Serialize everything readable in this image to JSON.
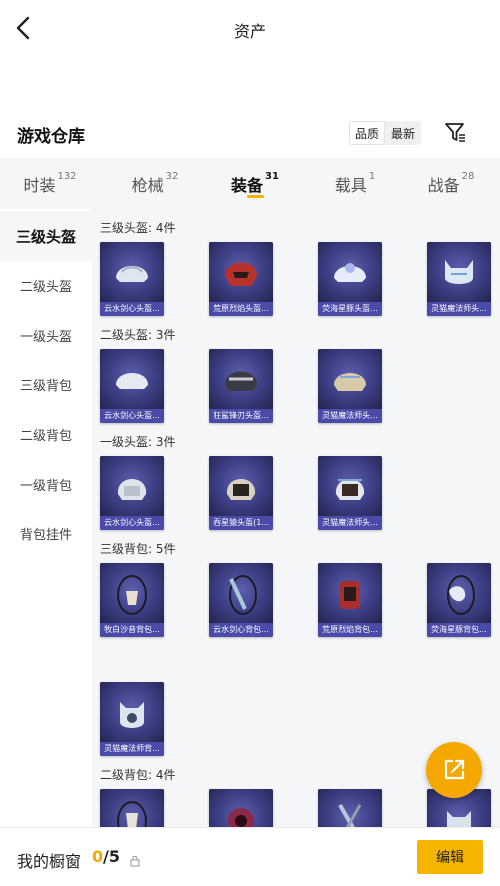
{
  "header": {
    "title": "资产"
  },
  "warehouse": {
    "title": "游戏仓库",
    "sort_options": [
      "品质",
      "最新"
    ]
  },
  "tabs": [
    {
      "label": "时装",
      "count": "132"
    },
    {
      "label": "枪械",
      "count": "32"
    },
    {
      "label": "装备",
      "count": "31"
    },
    {
      "label": "载具",
      "count": "1"
    },
    {
      "label": "战备",
      "count": "28"
    }
  ],
  "sidebar": {
    "items": [
      "三级头盔",
      "二级头盔",
      "一级头盔",
      "三级背包",
      "二级背包",
      "一级背包",
      "背包挂件"
    ]
  },
  "sections": [
    {
      "title": "三级头盔: 4件",
      "items": [
        "云水剑心头盔...",
        "荒原烈焰头盔...",
        "荧海星豚头盔...",
        "灵猫魔法师头..."
      ]
    },
    {
      "title": "二级头盔: 3件",
      "items": [
        "云水剑心头盔...",
        "狂鲨锋刃头盔...",
        "灵猫魔法师头..."
      ]
    },
    {
      "title": "一级头盔: 3件",
      "items": [
        "云水剑心头盔...",
        "吞星猿头盔(1...",
        "灵猫魔法师头..."
      ]
    },
    {
      "title": "三级背包: 5件",
      "items": [
        "牧白沙音背包...",
        "云水剑心背包...",
        "荒原烈焰背包...",
        "荧海星豚背包...",
        "灵猫魔法师背..."
      ]
    },
    {
      "title": "二级背包: 4件",
      "items": [
        "",
        "",
        "",
        ""
      ]
    }
  ],
  "bottom": {
    "showcase_label": "我的橱窗",
    "count_current": "0",
    "count_total": "/5",
    "edit_label": "编辑"
  },
  "colors": {
    "accent": "#f5b400",
    "card_bg": "#2a2c5c",
    "card_label": "#4a4aa8"
  }
}
